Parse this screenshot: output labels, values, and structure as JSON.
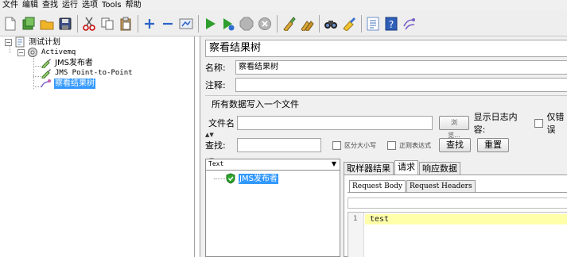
{
  "menu": {
    "items": [
      "文件",
      "编辑",
      "查找",
      "运行",
      "选项",
      "Tools",
      "帮助"
    ]
  },
  "toolbar": {
    "icons": [
      "new-icon",
      "templates-icon",
      "open-icon",
      "save-icon",
      "cut-icon",
      "copy-icon",
      "paste-icon",
      "expand-icon",
      "collapse-icon",
      "toggle-icon",
      "start-icon",
      "start-no-pause-icon",
      "stop-icon",
      "shutdown-icon",
      "clear-icon",
      "clear-all-icon",
      "search-icon",
      "reset-search-icon",
      "function-helper-icon",
      "help-icon",
      "remote-icon"
    ]
  },
  "tree": {
    "nodes": [
      {
        "label": "测试计划",
        "expander": "−"
      },
      {
        "label": "Activemq",
        "expander": "−"
      },
      {
        "label": "JMS发布者"
      },
      {
        "label": "JMS Point-to-Point"
      },
      {
        "label": "察看结果树"
      }
    ]
  },
  "panel": {
    "title": "察看结果树",
    "name_label": "名称:",
    "name_value": "察看结果树",
    "comment_label": "注释:",
    "comment_value": "",
    "file_group_title": "所有数据写入一个文件",
    "filename_label": "文件名",
    "filename_value": "",
    "browse_button": "浏览...",
    "log_content_label": "显示日志内容:",
    "errors_only_label": "仅错误",
    "search_label": "查找:",
    "search_value": "",
    "case_sensitive_label": "区分大小写",
    "regex_label": "正则表达式",
    "search_button": "查找",
    "reset_button": "重置"
  },
  "results": {
    "renderer": "Text",
    "samples": [
      {
        "label": "JMS发布者",
        "status": "success"
      }
    ],
    "tabs": [
      "取样器结果",
      "请求",
      "响应数据"
    ],
    "active_tab": "请求",
    "subtabs": [
      "Request Body",
      "Request Headers"
    ],
    "active_subtab": "Request Body",
    "body_lines": [
      {
        "number": "1",
        "text": "test"
      }
    ]
  }
}
